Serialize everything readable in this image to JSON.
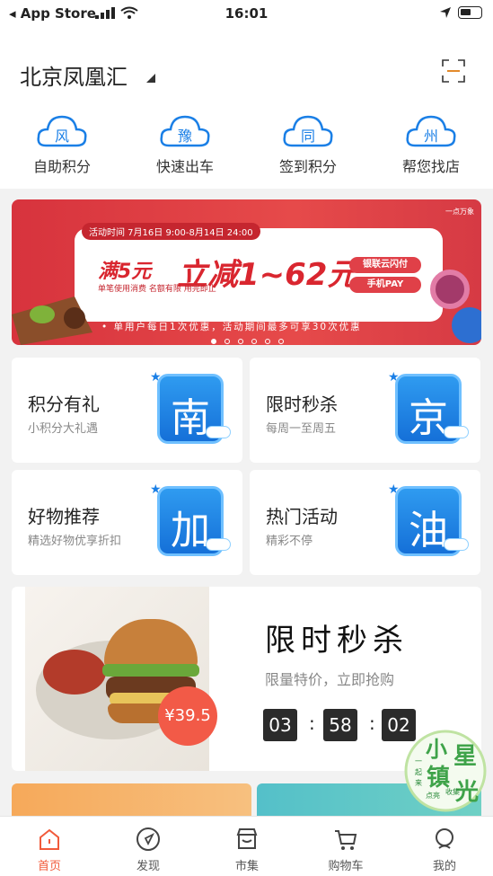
{
  "status_bar": {
    "back_app": "◂ App Store",
    "time": "16:01"
  },
  "header": {
    "city": "北京凤凰汇"
  },
  "quick_actions": [
    {
      "label": "自助积分",
      "icon": "cloud-feng-icon",
      "char": "风"
    },
    {
      "label": "快速出车",
      "icon": "cloud-yu-icon",
      "char": "豫"
    },
    {
      "label": "签到积分",
      "icon": "cloud-tong-icon",
      "char": "同"
    },
    {
      "label": "帮您找店",
      "icon": "cloud-zhou-icon",
      "char": "州"
    }
  ],
  "banner": {
    "period": "活动时间 7月16日 9:00-8月14日 24:00",
    "logo": "一点万象",
    "headline": "满5元",
    "headline2": "立减1~62元",
    "sub": "单笔使用消费 名额有限 用完即止",
    "pill1": "银联云闪付",
    "pill2": "手机PAY",
    "footer": "• 单用户每日1次优惠，活动期间最多可享30次优惠"
  },
  "tiles": [
    {
      "title": "积分有礼",
      "sub": "小积分大礼遇",
      "badge": "南"
    },
    {
      "title": "限时秒杀",
      "sub": "每周一至周五",
      "badge": "京"
    },
    {
      "title": "好物推荐",
      "sub": "精选好物优享折扣",
      "badge": "加"
    },
    {
      "title": "热门活动",
      "sub": "精彩不停",
      "badge": "油"
    }
  ],
  "flash_sale": {
    "title": "限时秒杀",
    "sub": "限量特价，立即抢购",
    "price": "¥39.5",
    "countdown": [
      "03",
      "58",
      "02"
    ]
  },
  "float_logo": {
    "big": "小镇星光",
    "small": "一起来点亮 收集"
  },
  "tabbar": [
    {
      "label": "首页",
      "icon": "home-icon",
      "active": true
    },
    {
      "label": "发现",
      "icon": "compass-icon",
      "active": false
    },
    {
      "label": "市集",
      "icon": "shop-icon",
      "active": false
    },
    {
      "label": "购物车",
      "icon": "cart-icon",
      "active": false
    },
    {
      "label": "我的",
      "icon": "profile-icon",
      "active": false
    }
  ],
  "colors": {
    "accent": "#f15a3a",
    "badge_blue": "#1a7fe6",
    "banner_red": "#d7333d"
  }
}
